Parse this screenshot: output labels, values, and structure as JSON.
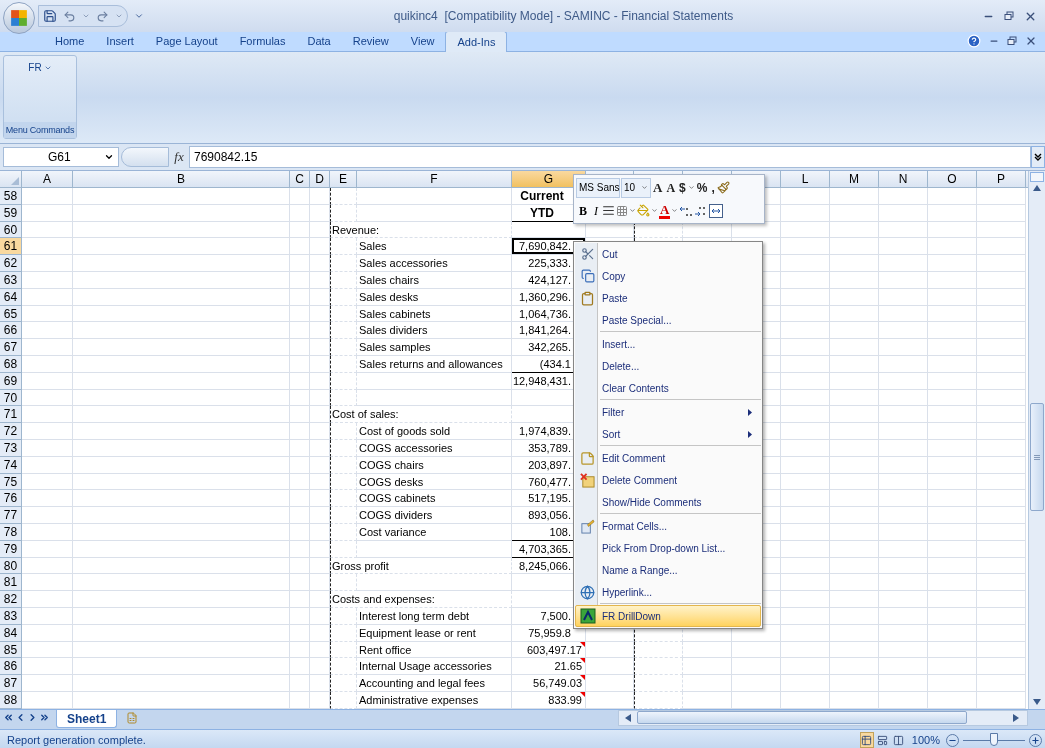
{
  "window": {
    "title": "quikinc4  [Compatibility Mode] - SAMINC - Financial Statements"
  },
  "ribbon_tabs": [
    {
      "label": "Home",
      "selected": false
    },
    {
      "label": "Insert",
      "selected": false
    },
    {
      "label": "Page Layout",
      "selected": false
    },
    {
      "label": "Formulas",
      "selected": false
    },
    {
      "label": "Data",
      "selected": false
    },
    {
      "label": "Review",
      "selected": false
    },
    {
      "label": "View",
      "selected": false
    },
    {
      "label": "Add-Ins",
      "selected": true
    }
  ],
  "ribbon_group": {
    "button": "FR",
    "caption": "Menu Commands"
  },
  "formula_bar": {
    "name_box": "G61",
    "fx": "fx",
    "value": "7690842.15"
  },
  "columns": [
    {
      "label": "A",
      "selected": false
    },
    {
      "label": "B",
      "selected": false
    },
    {
      "label": "C",
      "selected": false
    },
    {
      "label": "D",
      "selected": false
    },
    {
      "label": "E",
      "selected": false
    },
    {
      "label": "F",
      "selected": false
    },
    {
      "label": "G",
      "selected": true
    },
    {
      "selected": false
    },
    {
      "selected": false
    },
    {
      "selected": false
    },
    {
      "selected": false
    },
    {
      "label": "L",
      "selected": false
    },
    {
      "label": "M",
      "selected": false
    },
    {
      "label": "N",
      "selected": false
    },
    {
      "label": "O",
      "selected": false
    },
    {
      "label": "P",
      "selected": false
    }
  ],
  "rows": [
    {
      "number": "58",
      "kind": "header",
      "value": "Current",
      "underlined": false,
      "selected": false
    },
    {
      "number": "59",
      "kind": "header",
      "value": "YTD",
      "underlined": true,
      "selected": false
    },
    {
      "number": "60",
      "kind": "heading",
      "label": "Revenue:",
      "underlined": false,
      "selected": false
    },
    {
      "number": "61",
      "kind": "item",
      "label": "Sales",
      "value": "7,690,842.",
      "underlined": false,
      "selected": true
    },
    {
      "number": "62",
      "kind": "item",
      "label": "Sales accessories",
      "value": "225,333.",
      "underlined": false,
      "selected": false
    },
    {
      "number": "63",
      "kind": "item",
      "label": "Sales chairs",
      "value": "424,127.",
      "underlined": false,
      "selected": false
    },
    {
      "number": "64",
      "kind": "item",
      "label": "Sales desks",
      "value": "1,360,296.",
      "underlined": false,
      "selected": false
    },
    {
      "number": "65",
      "kind": "item",
      "label": "Sales cabinets",
      "value": "1,064,736.",
      "underlined": false,
      "selected": false
    },
    {
      "number": "66",
      "kind": "item",
      "label": "Sales dividers",
      "value": "1,841,264.",
      "underlined": false,
      "selected": false
    },
    {
      "number": "67",
      "kind": "item",
      "label": "Sales samples",
      "value": "342,265.",
      "underlined": false,
      "selected": false
    },
    {
      "number": "68",
      "kind": "item",
      "label": "Sales returns and allowances",
      "value": "(434.1",
      "underlined": true,
      "selected": false
    },
    {
      "number": "69",
      "kind": "item",
      "value": "12,948,431.",
      "underlined": false,
      "selected": false
    },
    {
      "number": "70",
      "kind": "blank",
      "underlined": false,
      "selected": false
    },
    {
      "number": "71",
      "kind": "heading",
      "label": "Cost of sales:",
      "underlined": false,
      "selected": false
    },
    {
      "number": "72",
      "kind": "item",
      "label": "Cost of goods sold",
      "value": "1,974,839.",
      "underlined": false,
      "selected": false
    },
    {
      "number": "73",
      "kind": "item",
      "label": "COGS accessories",
      "value": "353,789.",
      "underlined": false,
      "selected": false
    },
    {
      "number": "74",
      "kind": "item",
      "label": "COGS chairs",
      "value": "203,897.",
      "underlined": false,
      "selected": false
    },
    {
      "number": "75",
      "kind": "item",
      "label": "COGS desks",
      "value": "760,477.",
      "underlined": false,
      "selected": false
    },
    {
      "number": "76",
      "kind": "item",
      "label": "COGS cabinets",
      "value": "517,195.",
      "underlined": false,
      "selected": false
    },
    {
      "number": "77",
      "kind": "item",
      "label": "COGS dividers",
      "value": "893,056.",
      "underlined": false,
      "selected": false
    },
    {
      "number": "78",
      "kind": "item",
      "label": "Cost variance",
      "value": "108.",
      "underlined": true,
      "selected": false
    },
    {
      "number": "79",
      "kind": "item",
      "value": "4,703,365.",
      "underlined": true,
      "selected": false
    },
    {
      "number": "80",
      "kind": "heading",
      "label": "Gross profit",
      "value": "8,245,066.",
      "underlined": false,
      "selected": false
    },
    {
      "number": "81",
      "kind": "blank",
      "underlined": false,
      "selected": false
    },
    {
      "number": "82",
      "kind": "heading",
      "label": "Costs and expenses:",
      "underlined": false,
      "selected": false
    },
    {
      "number": "83",
      "kind": "item",
      "label": "Interest long term debt",
      "value": "7,500.",
      "underlined": false,
      "selected": false
    },
    {
      "number": "84",
      "kind": "item",
      "label": "Equipment lease or rent",
      "value": "75,959.8",
      "underlined": false,
      "selected": false
    },
    {
      "number": "85",
      "kind": "item",
      "label": "Rent office",
      "value": "603,497.17",
      "underlined": false,
      "comment": true,
      "selected": false
    },
    {
      "number": "86",
      "kind": "item",
      "label": "Internal Usage accessories",
      "value": "21.65",
      "underlined": false,
      "comment": true,
      "selected": false
    },
    {
      "number": "87",
      "kind": "item",
      "label": "Accounting and legal fees",
      "value": "56,749.03",
      "underlined": false,
      "comment": true,
      "selected": false
    },
    {
      "number": "88",
      "kind": "item",
      "label": "Administrative expenses",
      "value": "833.99",
      "underlined": false,
      "comment": true,
      "selected": false
    }
  ],
  "mini_toolbar": {
    "font": "MS Sans",
    "size": "10",
    "grow": "A",
    "shrink": "A",
    "currency": "$",
    "percent": "%",
    "comma": ",",
    "bold": "B",
    "italic": "I",
    "font_color": "A"
  },
  "context_menu": {
    "groups": [
      [
        {
          "label": "Cut",
          "kind": "scissors",
          "submenu": false,
          "selected": false
        },
        {
          "label": "Copy",
          "kind": "copy",
          "submenu": false,
          "selected": false
        },
        {
          "label": "Paste",
          "kind": "paste",
          "submenu": false,
          "selected": false
        },
        {
          "label": "Paste Special...",
          "kind": "plain",
          "submenu": false,
          "selected": false
        }
      ],
      [
        {
          "label": "Insert...",
          "kind": "plain",
          "submenu": false,
          "selected": false
        },
        {
          "label": "Delete...",
          "kind": "plain",
          "submenu": false,
          "selected": false
        },
        {
          "label": "Clear Contents",
          "kind": "plain",
          "submenu": false,
          "selected": false
        }
      ],
      [
        {
          "label": "Filter",
          "kind": "plain",
          "submenu": true,
          "selected": false
        },
        {
          "label": "Sort",
          "kind": "plain",
          "submenu": true,
          "selected": false
        }
      ],
      [
        {
          "label": "Edit Comment",
          "kind": "note",
          "submenu": false,
          "selected": false
        },
        {
          "label": "Delete Comment",
          "kind": "note-delete",
          "submenu": false,
          "selected": false
        },
        {
          "label": "Show/Hide Comments",
          "kind": "plain",
          "submenu": false,
          "selected": false
        }
      ],
      [
        {
          "label": "Format Cells...",
          "kind": "format",
          "submenu": false,
          "selected": false
        },
        {
          "label": "Pick From Drop-down List...",
          "kind": "plain",
          "submenu": false,
          "selected": false
        },
        {
          "label": "Name a Range...",
          "kind": "plain",
          "submenu": false,
          "selected": false
        },
        {
          "label": "Hyperlink...",
          "kind": "globe",
          "submenu": false,
          "selected": false
        }
      ],
      [
        {
          "label": "FR DrillDown",
          "kind": "addin",
          "submenu": false,
          "selected": true
        }
      ]
    ]
  },
  "sheet_tabs": [
    {
      "label": "Sheet1",
      "selected": true
    }
  ],
  "status_bar": {
    "message": "Report generation complete.",
    "views": [
      {
        "kind": "normal",
        "selected": true
      },
      {
        "kind": "layout",
        "selected": false
      },
      {
        "kind": "break",
        "selected": false
      }
    ],
    "zoom": "100%",
    "zoom_slider": {
      "level": 0.5
    }
  }
}
